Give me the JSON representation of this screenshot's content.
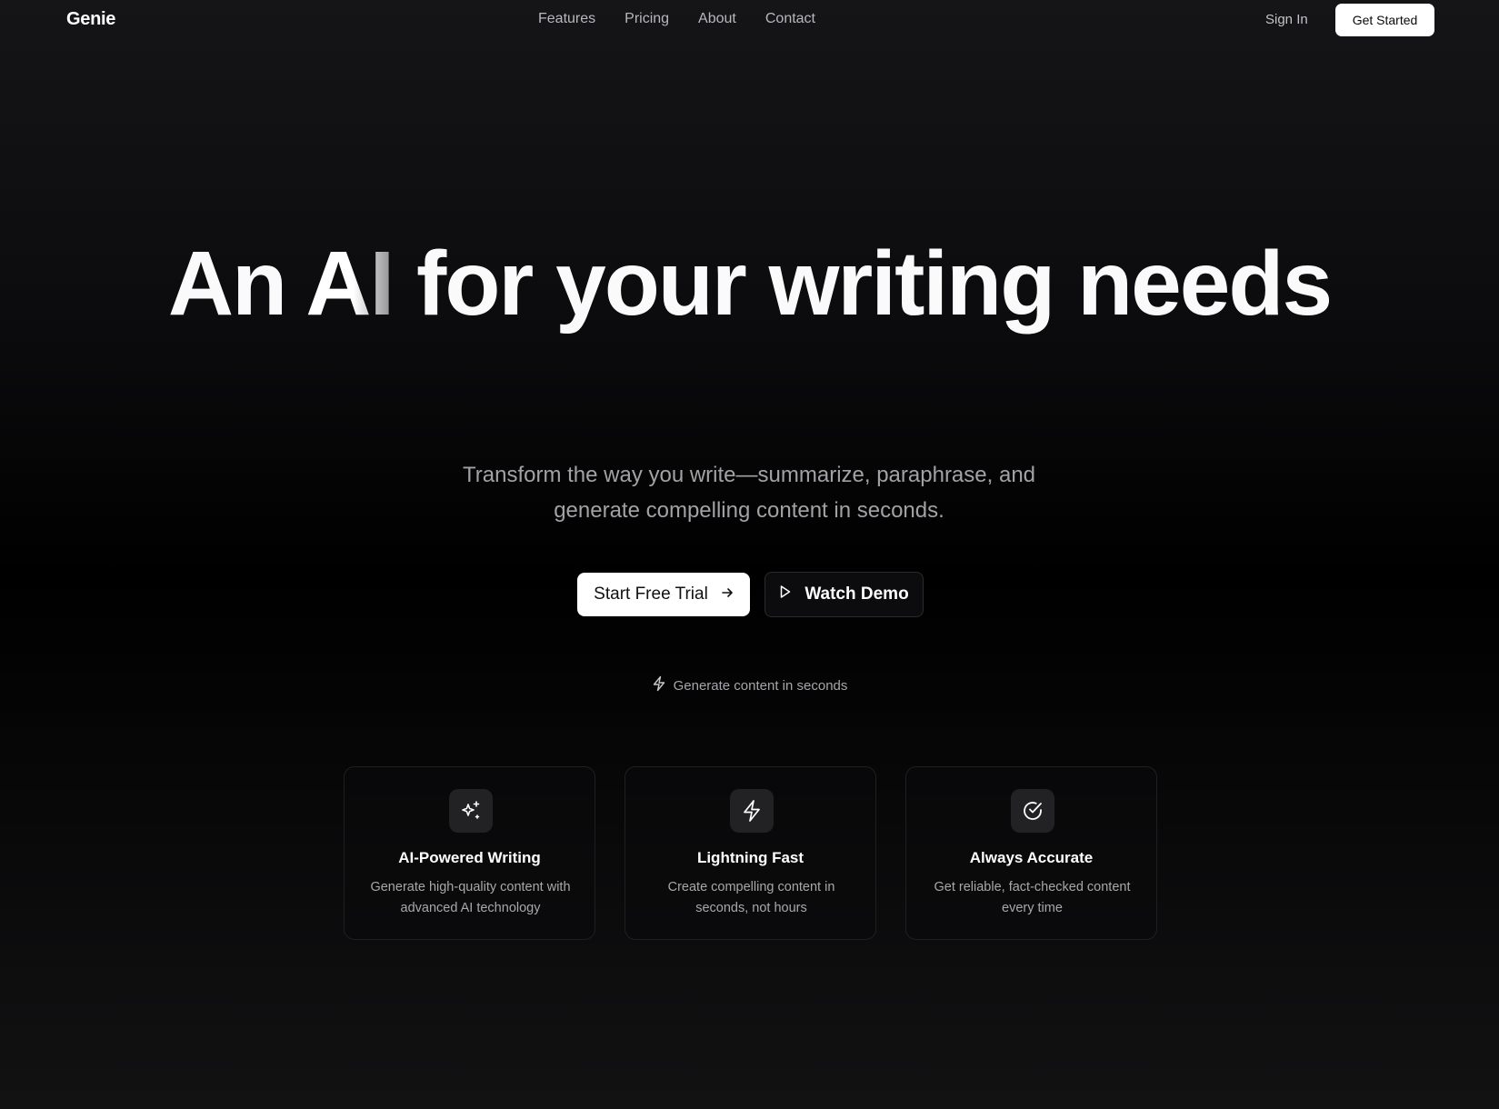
{
  "nav": {
    "logo": "Genie",
    "links": [
      "Features",
      "Pricing",
      "About",
      "Contact"
    ],
    "sign_in": "Sign In",
    "get_started": "Get Started"
  },
  "hero": {
    "title_part1": "An ",
    "title_highlight": "AI",
    "title_part2": " for your writing needs",
    "subtitle": "Transform the way you write—summarize, paraphrase, and generate compelling content in seconds.",
    "primary_cta": "Start Free Trial",
    "primary_cta_icon": "arrow-right-icon",
    "secondary_cta": "Watch Demo",
    "secondary_cta_icon": "play-icon",
    "tagline": "Generate content in seconds",
    "tagline_icon": "lightning-icon"
  },
  "features": [
    {
      "icon": "sparkles-icon",
      "title": "AI-Powered Writing",
      "description": "Generate high-quality content with advanced AI technology"
    },
    {
      "icon": "lightning-icon",
      "title": "Lightning Fast",
      "description": "Create compelling content in seconds, not hours"
    },
    {
      "icon": "check-circle-icon",
      "title": "Always Accurate",
      "description": "Get reliable, fact-checked content every time"
    }
  ],
  "colors": {
    "background": "#000000",
    "primary_button_bg": "#ffffff",
    "muted_text": "#a2a2a6",
    "card_border": "#1f1f22",
    "icon_tile": "#222225"
  }
}
